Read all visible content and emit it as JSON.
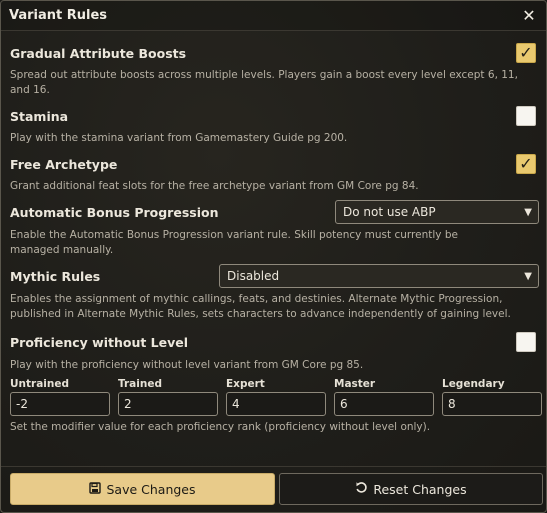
{
  "window": {
    "title": "Variant Rules",
    "close_icon": "close-icon"
  },
  "settings": [
    {
      "label": "Gradual Attribute Boosts",
      "hint": "Spread out attribute boosts across multiple levels. Players gain a boost every level except 6, 11, and 16.",
      "control": "checkbox",
      "checked": true
    },
    {
      "label": "Stamina",
      "hint": "Play with the stamina variant from Gamemastery Guide pg 200.",
      "control": "checkbox",
      "checked": false
    },
    {
      "label": "Free Archetype",
      "hint": "Grant additional feat slots for the free archetype variant from GM Core pg 84.",
      "control": "checkbox",
      "checked": true
    },
    {
      "label": "Automatic Bonus Progression",
      "hint": "Enable the Automatic Bonus Progression variant rule. Skill potency must currently be managed manually.",
      "control": "select",
      "value": "Do not use ABP"
    },
    {
      "label": "Mythic Rules",
      "hint": "Enables the assignment of mythic callings, feats, and destinies. Alternate Mythic Progression, published in Alternate Mythic Rules, sets characters to advance independently of gaining level.",
      "control": "select",
      "value": "Disabled"
    },
    {
      "label": "Proficiency without Level",
      "hint": "Play with the proficiency without level variant from GM Core pg 85.",
      "control": "checkbox",
      "checked": false
    }
  ],
  "ranks": {
    "items": [
      {
        "label": "Untrained",
        "value": "-2"
      },
      {
        "label": "Trained",
        "value": "2"
      },
      {
        "label": "Expert",
        "value": "4"
      },
      {
        "label": "Master",
        "value": "6"
      },
      {
        "label": "Legendary",
        "value": "8"
      }
    ],
    "hint": "Set the modifier value for each proficiency rank (proficiency without level only)."
  },
  "buttons": {
    "save": {
      "label": "Save Changes",
      "icon": "save-icon"
    },
    "reset": {
      "label": "Reset Changes",
      "icon": "undo-icon"
    }
  },
  "colors": {
    "accent": "#e9c96f",
    "save_button": "#e8cb8a",
    "background": "#1f1e1a"
  }
}
